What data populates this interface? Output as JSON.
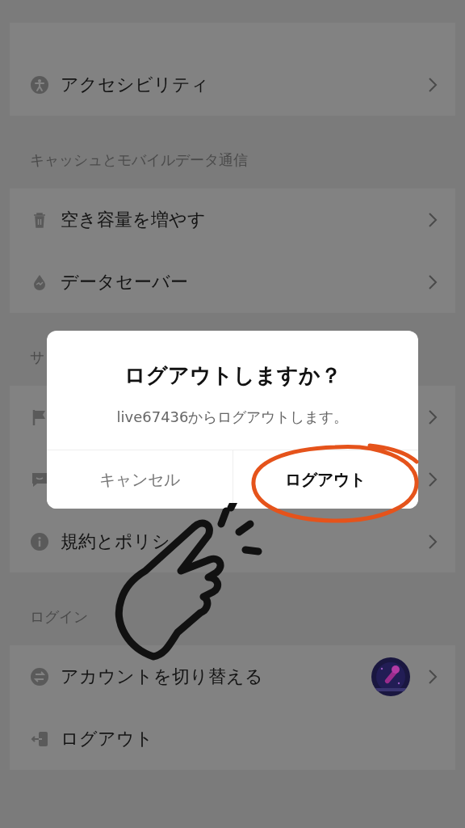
{
  "cards": [
    {
      "rows": [
        {
          "label": "アクセシビリティ",
          "chevron": true
        }
      ]
    },
    {
      "header": "キャッシュとモバイルデータ通信",
      "rows": [
        {
          "label": "空き容量を増やす",
          "chevron": true
        },
        {
          "label": "データセーバー",
          "chevron": true
        }
      ]
    },
    {
      "header": "サ",
      "rows": [
        {
          "chevron": true
        },
        {
          "chevron": true
        },
        {
          "label": "規約とポリシ",
          "chevron": true
        }
      ]
    },
    {
      "header": "ログイン",
      "rows": [
        {
          "label": "アカウントを切り替える",
          "chevron": true
        },
        {
          "label": "ログアウト",
          "chevron": false
        }
      ]
    }
  ],
  "dialog": {
    "title": "ログアウトしますか？",
    "message": "live67436からログアウトします。",
    "buttons": [
      {
        "label": "キャンセル",
        "kind": "cancel"
      },
      {
        "label": "ログアウト",
        "kind": "confirm"
      }
    ]
  }
}
